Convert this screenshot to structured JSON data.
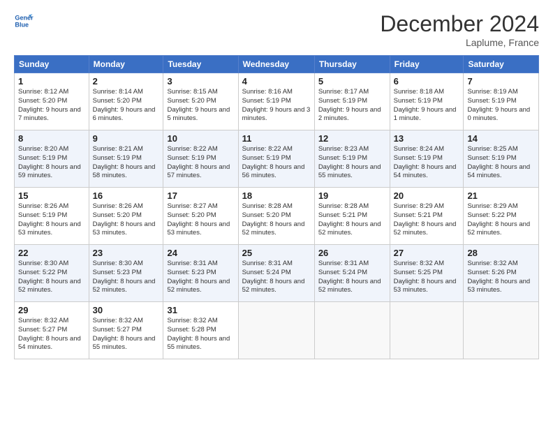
{
  "logo": {
    "line1": "General",
    "line2": "Blue"
  },
  "title": "December 2024",
  "location": "Laplume, France",
  "days_of_week": [
    "Sunday",
    "Monday",
    "Tuesday",
    "Wednesday",
    "Thursday",
    "Friday",
    "Saturday"
  ],
  "weeks": [
    [
      {
        "day": "1",
        "sunrise": "8:12 AM",
        "sunset": "5:20 PM",
        "daylight": "9 hours and 7 minutes."
      },
      {
        "day": "2",
        "sunrise": "8:14 AM",
        "sunset": "5:20 PM",
        "daylight": "9 hours and 6 minutes."
      },
      {
        "day": "3",
        "sunrise": "8:15 AM",
        "sunset": "5:20 PM",
        "daylight": "9 hours and 5 minutes."
      },
      {
        "day": "4",
        "sunrise": "8:16 AM",
        "sunset": "5:19 PM",
        "daylight": "9 hours and 3 minutes."
      },
      {
        "day": "5",
        "sunrise": "8:17 AM",
        "sunset": "5:19 PM",
        "daylight": "9 hours and 2 minutes."
      },
      {
        "day": "6",
        "sunrise": "8:18 AM",
        "sunset": "5:19 PM",
        "daylight": "9 hours and 1 minute."
      },
      {
        "day": "7",
        "sunrise": "8:19 AM",
        "sunset": "5:19 PM",
        "daylight": "9 hours and 0 minutes."
      }
    ],
    [
      {
        "day": "8",
        "sunrise": "8:20 AM",
        "sunset": "5:19 PM",
        "daylight": "8 hours and 59 minutes."
      },
      {
        "day": "9",
        "sunrise": "8:21 AM",
        "sunset": "5:19 PM",
        "daylight": "8 hours and 58 minutes."
      },
      {
        "day": "10",
        "sunrise": "8:22 AM",
        "sunset": "5:19 PM",
        "daylight": "8 hours and 57 minutes."
      },
      {
        "day": "11",
        "sunrise": "8:22 AM",
        "sunset": "5:19 PM",
        "daylight": "8 hours and 56 minutes."
      },
      {
        "day": "12",
        "sunrise": "8:23 AM",
        "sunset": "5:19 PM",
        "daylight": "8 hours and 55 minutes."
      },
      {
        "day": "13",
        "sunrise": "8:24 AM",
        "sunset": "5:19 PM",
        "daylight": "8 hours and 54 minutes."
      },
      {
        "day": "14",
        "sunrise": "8:25 AM",
        "sunset": "5:19 PM",
        "daylight": "8 hours and 54 minutes."
      }
    ],
    [
      {
        "day": "15",
        "sunrise": "8:26 AM",
        "sunset": "5:19 PM",
        "daylight": "8 hours and 53 minutes."
      },
      {
        "day": "16",
        "sunrise": "8:26 AM",
        "sunset": "5:20 PM",
        "daylight": "8 hours and 53 minutes."
      },
      {
        "day": "17",
        "sunrise": "8:27 AM",
        "sunset": "5:20 PM",
        "daylight": "8 hours and 53 minutes."
      },
      {
        "day": "18",
        "sunrise": "8:28 AM",
        "sunset": "5:20 PM",
        "daylight": "8 hours and 52 minutes."
      },
      {
        "day": "19",
        "sunrise": "8:28 AM",
        "sunset": "5:21 PM",
        "daylight": "8 hours and 52 minutes."
      },
      {
        "day": "20",
        "sunrise": "8:29 AM",
        "sunset": "5:21 PM",
        "daylight": "8 hours and 52 minutes."
      },
      {
        "day": "21",
        "sunrise": "8:29 AM",
        "sunset": "5:22 PM",
        "daylight": "8 hours and 52 minutes."
      }
    ],
    [
      {
        "day": "22",
        "sunrise": "8:30 AM",
        "sunset": "5:22 PM",
        "daylight": "8 hours and 52 minutes."
      },
      {
        "day": "23",
        "sunrise": "8:30 AM",
        "sunset": "5:23 PM",
        "daylight": "8 hours and 52 minutes."
      },
      {
        "day": "24",
        "sunrise": "8:31 AM",
        "sunset": "5:23 PM",
        "daylight": "8 hours and 52 minutes."
      },
      {
        "day": "25",
        "sunrise": "8:31 AM",
        "sunset": "5:24 PM",
        "daylight": "8 hours and 52 minutes."
      },
      {
        "day": "26",
        "sunrise": "8:31 AM",
        "sunset": "5:24 PM",
        "daylight": "8 hours and 52 minutes."
      },
      {
        "day": "27",
        "sunrise": "8:32 AM",
        "sunset": "5:25 PM",
        "daylight": "8 hours and 53 minutes."
      },
      {
        "day": "28",
        "sunrise": "8:32 AM",
        "sunset": "5:26 PM",
        "daylight": "8 hours and 53 minutes."
      }
    ],
    [
      {
        "day": "29",
        "sunrise": "8:32 AM",
        "sunset": "5:27 PM",
        "daylight": "8 hours and 54 minutes."
      },
      {
        "day": "30",
        "sunrise": "8:32 AM",
        "sunset": "5:27 PM",
        "daylight": "8 hours and 55 minutes."
      },
      {
        "day": "31",
        "sunrise": "8:32 AM",
        "sunset": "5:28 PM",
        "daylight": "8 hours and 55 minutes."
      },
      null,
      null,
      null,
      null
    ]
  ]
}
